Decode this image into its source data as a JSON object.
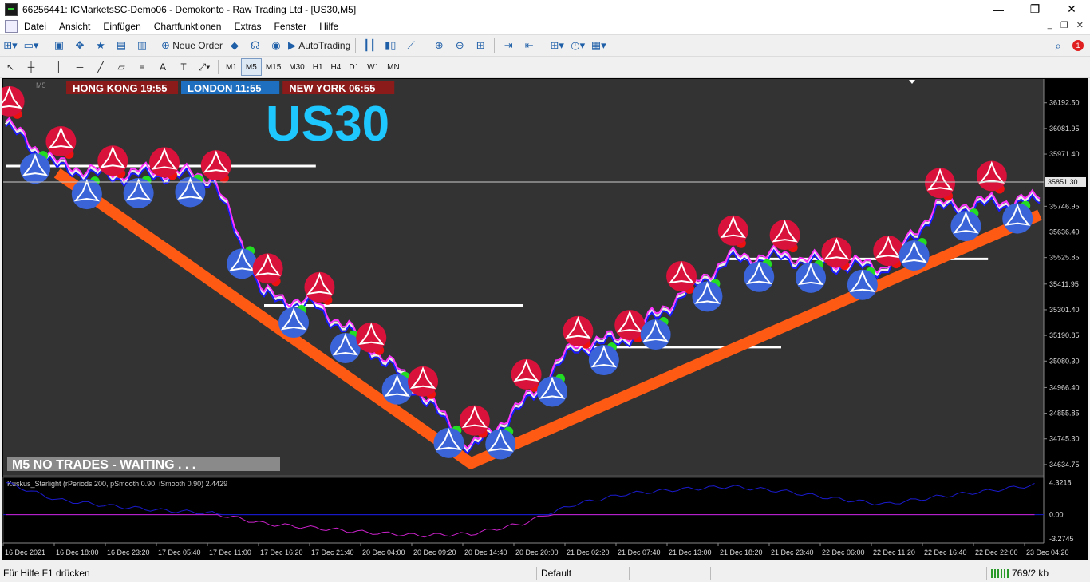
{
  "window": {
    "title": "66256441: ICMarketsSC-Demo06 - Demokonto - Raw Trading Ltd - [US30,M5]",
    "controls": [
      "—",
      "❐",
      "✕"
    ]
  },
  "menu": [
    "Datei",
    "Ansicht",
    "Einfügen",
    "Chartfunktionen",
    "Extras",
    "Fenster",
    "Hilfe"
  ],
  "toolbar": {
    "new_order": "Neue Order",
    "autotrading": "AutoTrading",
    "notification_count": "1"
  },
  "timeframes": [
    "M1",
    "M5",
    "M15",
    "M30",
    "H1",
    "H4",
    "D1",
    "W1",
    "MN"
  ],
  "active_timeframe": "M5",
  "chart": {
    "symbol": "US30",
    "period_label": "M5",
    "sessions": [
      {
        "label": "HONG KONG 19:55",
        "color": "#8b1a1a"
      },
      {
        "label": "LONDON  11:55",
        "color": "#1f6fc0"
      },
      {
        "label": "NEW YORK  06:55",
        "color": "#8b1a1a"
      }
    ],
    "status_message": "M5  NO TRADES - WAITING . . .",
    "current_price": "35851.30",
    "price_ticks": [
      "36192.50",
      "36081.95",
      "35971.40",
      "35746.95",
      "35636.40",
      "35525.85",
      "35411.95",
      "35301.40",
      "35190.85",
      "35080.30",
      "34966.40",
      "34855.85",
      "34745.30",
      "34634.75"
    ],
    "time_ticks": [
      "16 Dec 2021",
      "16 Dec 18:00",
      "16 Dec 23:20",
      "17 Dec 05:40",
      "17 Dec 11:00",
      "17 Dec 16:20",
      "17 Dec 21:40",
      "20 Dec 04:00",
      "20 Dec 09:20",
      "20 Dec 14:40",
      "20 Dec 20:00",
      "21 Dec 02:20",
      "21 Dec 07:40",
      "21 Dec 13:00",
      "21 Dec 18:20",
      "21 Dec 23:40",
      "22 Dec 06:00",
      "22 Dec 11:20",
      "22 Dec 16:40",
      "22 Dec 22:00",
      "23 Dec 04:20"
    ],
    "colors": {
      "background": "#333333",
      "trend": "#ff5a14",
      "fast_line": "#ff33ff",
      "slow_line": "#1a1aff",
      "sell_signal": "#d8123a",
      "buy_signal": "#3a64d8",
      "dot_green": "#22dd22",
      "dot_red": "#ee1111"
    }
  },
  "indicator": {
    "label": "Kuskus_Starlight  (rPeriods 200, pSmooth 0.90, iSmooth 0.90)  2.4429",
    "ticks": [
      "4.3218",
      "0.00",
      "-3.2745"
    ],
    "colors": {
      "line": "#1a1acc",
      "signal": "#cc22cc",
      "zero": "#1a1acc"
    }
  },
  "chart_data": {
    "type": "line",
    "title": "US30",
    "xlabel": "",
    "ylabel": "",
    "ylim": [
      34600,
      36250
    ],
    "x": [
      "16 Dec 2021",
      "16 Dec 18:00",
      "16 Dec 23:20",
      "17 Dec 05:40",
      "17 Dec 11:00",
      "17 Dec 16:20",
      "17 Dec 21:40",
      "20 Dec 04:00",
      "20 Dec 09:20",
      "20 Dec 14:40",
      "20 Dec 20:00",
      "21 Dec 02:20",
      "21 Dec 07:40",
      "21 Dec 13:00",
      "21 Dec 18:20",
      "21 Dec 23:40",
      "22 Dec 06:00",
      "22 Dec 11:20",
      "22 Dec 16:40",
      "22 Dec 22:00",
      "23 Dec 04:20"
    ],
    "series": [
      {
        "values": [
          36100,
          35920,
          35880,
          35890,
          35870,
          35360,
          35320,
          35150,
          34950,
          34700,
          34890,
          35140,
          35180,
          35350,
          35520,
          35530,
          35500,
          35480,
          35740,
          35760,
          35770
        ]
      }
    ],
    "indicator_series": [
      {
        "values": [
          4.3,
          2.0,
          1.2,
          0.6,
          0.2,
          -1.2,
          -1.8,
          -2.4,
          -2.8,
          -2.6,
          -1.2,
          1.4,
          2.8,
          3.4,
          3.8,
          3.2,
          2.2,
          1.4,
          2.4,
          3.2,
          4.1
        ]
      }
    ],
    "grid": false,
    "legend": "none"
  },
  "status": {
    "help": "Für Hilfe F1 drücken",
    "profile": "Default",
    "traffic": "769/2 kb"
  }
}
